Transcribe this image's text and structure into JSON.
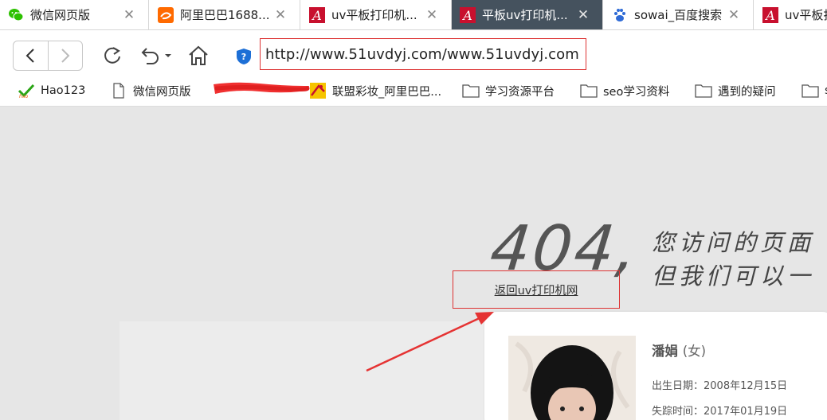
{
  "tabs": [
    {
      "label": "微信网页版",
      "icon": "wechat-icon"
    },
    {
      "label": "阿里巴巴1688...",
      "icon": "alibaba-icon"
    },
    {
      "label": "uv平板打印机...",
      "icon": "acrobat-icon"
    },
    {
      "label": "平板uv打印机...",
      "icon": "acrobat-icon",
      "active": true
    },
    {
      "label": "sowai_百度搜索",
      "icon": "baidu-paw-icon"
    },
    {
      "label": "uv平板打",
      "icon": "acrobat-icon"
    }
  ],
  "tab_close_glyph": "✕",
  "toolbar": {
    "url": "http://www.51uvdyj.com/www.51uvdyj.com"
  },
  "bookmarks": [
    {
      "label": "Hao123",
      "icon": "hao123-icon"
    },
    {
      "label": "微信网页版",
      "icon": "page-icon"
    },
    {
      "label": "联盟彩妆_阿里巴巴...",
      "icon": "bookmark-site-icon"
    },
    {
      "label": "学习资源平台",
      "icon": "folder-icon"
    },
    {
      "label": "seo学习资料",
      "icon": "folder-icon"
    },
    {
      "label": "遇到的疑问",
      "icon": "folder-icon"
    },
    {
      "label": "s",
      "icon": "folder-icon"
    }
  ],
  "content": {
    "error_code": "404,",
    "message_line1": "您访问的页面",
    "message_line2": "但我们可以一",
    "return_link": "返回uv打印机网",
    "card": {
      "name": "潘娟",
      "gender": "(女)",
      "birth": "出生日期：2008年12月15日",
      "missing": "失踪时间：2017年01月19日"
    }
  },
  "colors": {
    "active_tab": "#45525e",
    "highlight_box": "#dd3333",
    "page_bg": "#e6e6e6"
  }
}
